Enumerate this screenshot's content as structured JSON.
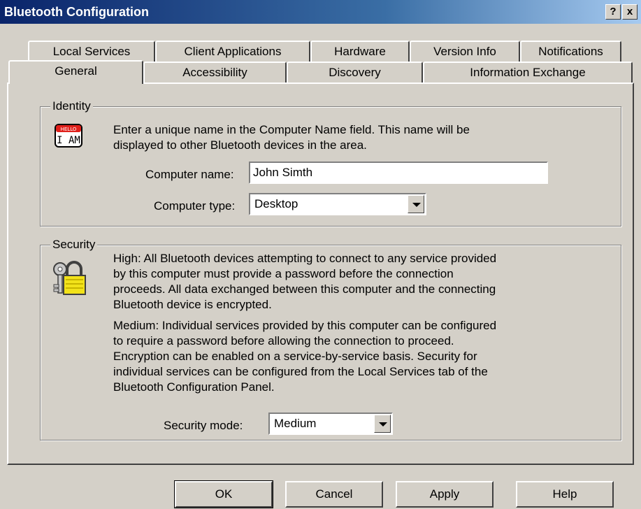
{
  "window": {
    "title": "Bluetooth Configuration",
    "help_button": "?",
    "close_button": "x"
  },
  "tabs_back": [
    {
      "label": "Local Services"
    },
    {
      "label": "Client Applications"
    },
    {
      "label": "Hardware"
    },
    {
      "label": "Version Info"
    },
    {
      "label": "Notifications"
    }
  ],
  "tabs_front": [
    {
      "label": "General",
      "active": true
    },
    {
      "label": "Accessibility"
    },
    {
      "label": "Discovery"
    },
    {
      "label": "Information Exchange"
    }
  ],
  "identity": {
    "legend": "Identity",
    "icon": "hello-i-am-badge-icon",
    "badge_top": "HELLO",
    "badge_text": "I AM",
    "description_line1": "Enter a unique name in the Computer Name field. This name will be",
    "description_line2": "displayed to other Bluetooth devices in the area.",
    "name_label": "Computer name:",
    "name_value": "John Simth",
    "type_label": "Computer type:",
    "type_value": "Desktop"
  },
  "security": {
    "legend": "Security",
    "icon": "lock-and-keys-icon",
    "high_lines": [
      "High: All Bluetooth devices attempting to connect to any service provided",
      "by this computer must provide a password before the connection",
      "proceeds. All data exchanged between this computer and the connecting",
      "Bluetooth device is encrypted."
    ],
    "medium_lines": [
      "Medium: Individual services provided by this computer can be configured",
      "to require a password before allowing the connection to proceed.",
      "Encryption can be enabled on a service-by-service basis. Security for",
      "individual services can be configured from the Local Services tab of the",
      "Bluetooth Configuration Panel."
    ],
    "mode_label": "Security mode:",
    "mode_value": "Medium"
  },
  "buttons": {
    "ok": "OK",
    "cancel": "Cancel",
    "apply": "Apply",
    "help": "Help"
  }
}
